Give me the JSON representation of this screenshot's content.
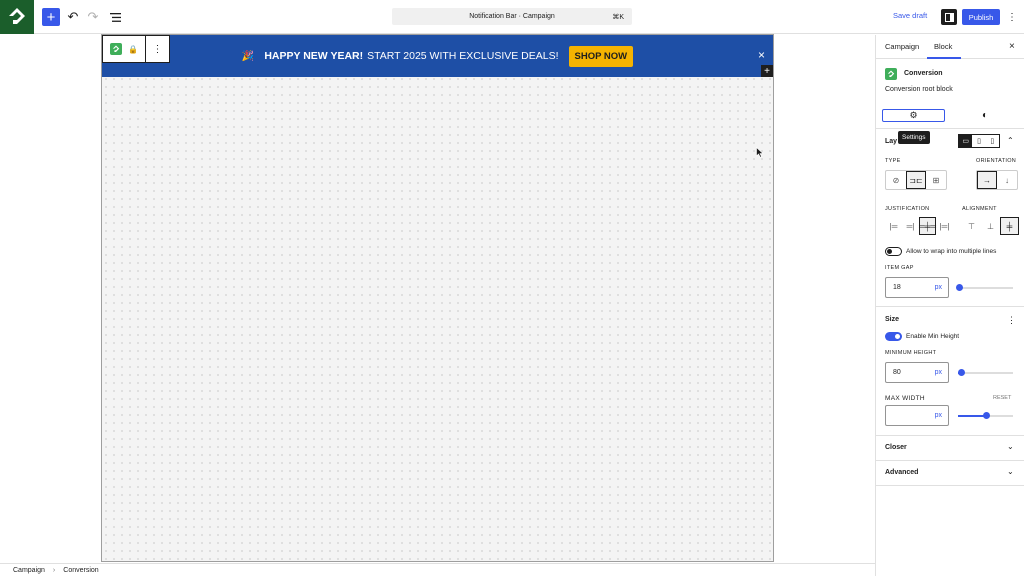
{
  "topbar": {
    "document_title": "Notification Bar · Campaign",
    "shortcut": "⌘K",
    "save_draft": "Save draft",
    "publish": "Publish"
  },
  "banner": {
    "emoji": "🎉",
    "headline_bold": "HAPPY NEW YEAR!",
    "headline_rest": "START 2025 WITH EXCLUSIVE DEALS!",
    "cta": "SHOP NOW",
    "close": "×",
    "background": "#1e4fa6",
    "cta_color": "#f5b301"
  },
  "breadcrumb": {
    "items": [
      "Campaign",
      "Conversion"
    ],
    "separator": "›"
  },
  "sidebar": {
    "tabs": [
      "Campaign",
      "Block"
    ],
    "active_tab": "Block",
    "block_name": "Conversion",
    "block_description": "Conversion root block",
    "tooltip": "Settings",
    "layout": {
      "title": "Layout",
      "type_label": "TYPE",
      "orientation_label": "ORIENTATION",
      "justification_label": "JUSTIFICATION",
      "alignment_label": "ALIGNMENT",
      "wrap_label": "Allow to wrap into multiple lines",
      "wrap_enabled": false,
      "item_gap_label": "ITEM GAP",
      "item_gap_value": "18",
      "item_gap_unit": "px",
      "item_gap_slider": 0.02
    },
    "size": {
      "title": "Size",
      "min_height_toggle_label": "Enable Min Height",
      "min_height_enabled": true,
      "min_height_label": "MINIMUM HEIGHT",
      "min_height_value": "80",
      "min_height_unit": "px",
      "min_height_slider": 0.06,
      "max_width_label": "MAX WIDTH",
      "max_width_reset": "RESET",
      "max_width_value": "",
      "max_width_unit": "px",
      "max_width_slider": 0.5
    },
    "closer": "Closer",
    "advanced": "Advanced"
  },
  "colors": {
    "accent": "#3858e9",
    "logo_bg": "#1b5e2b",
    "block_icon": "#3fae5a"
  }
}
